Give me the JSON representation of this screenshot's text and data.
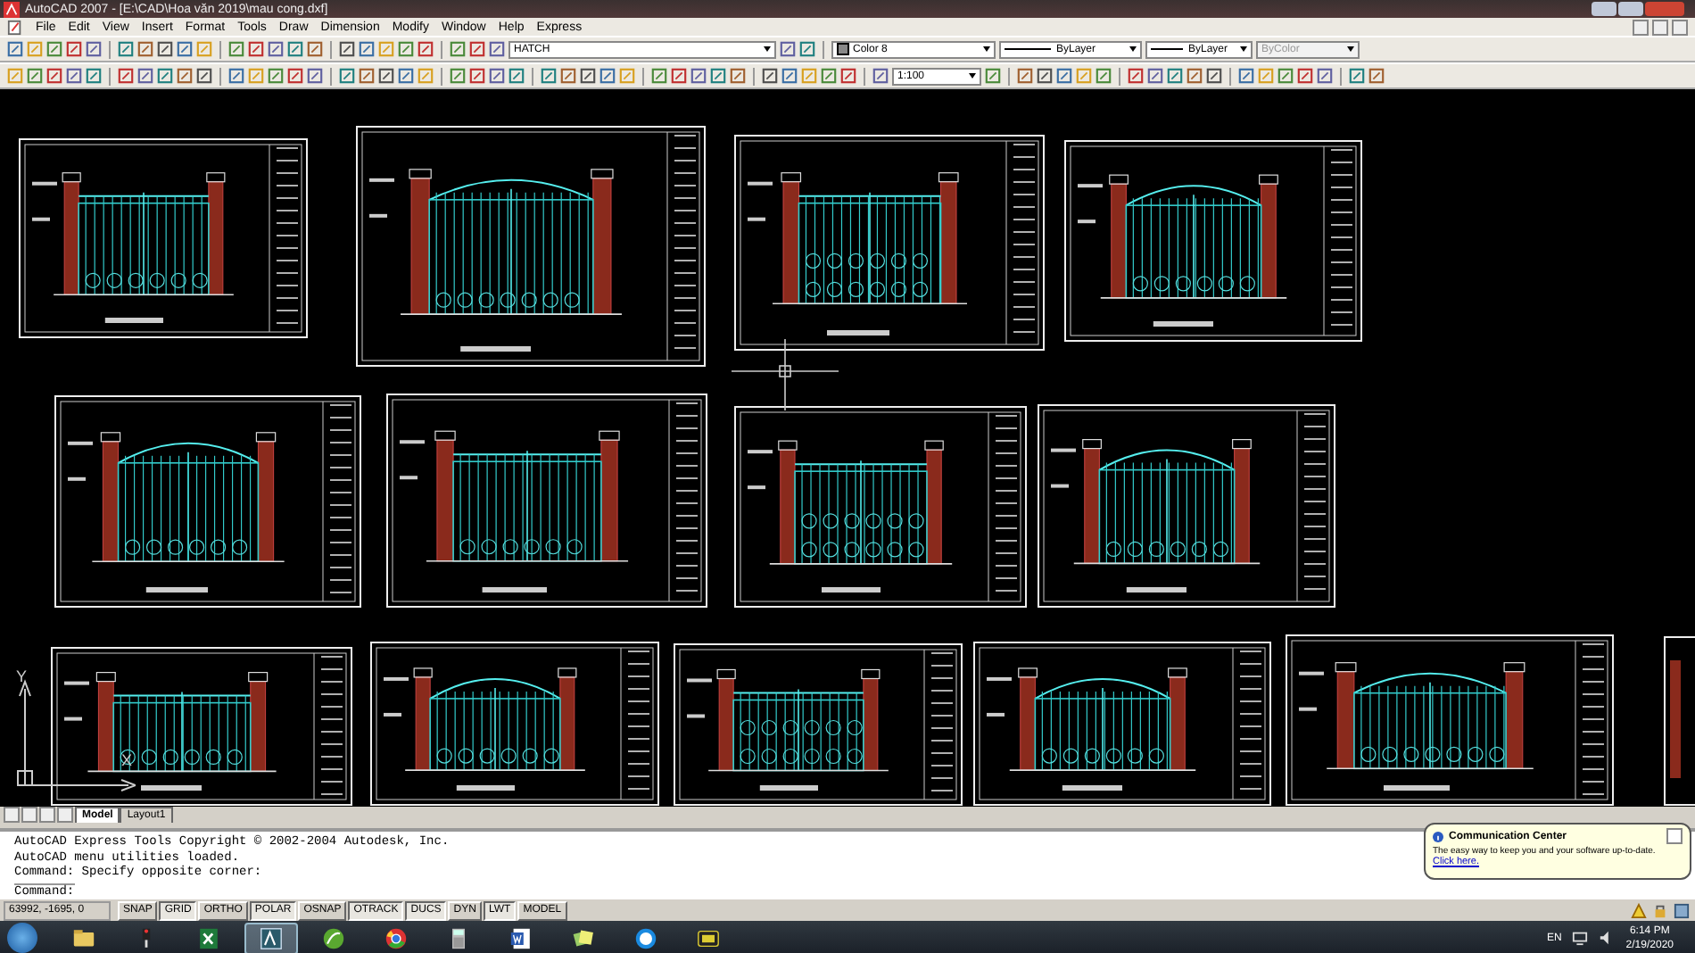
{
  "window": {
    "title": "AutoCAD 2007 - [E:\\CAD\\Hoa văn 2019\\mau cong.dxf]"
  },
  "menu": [
    "File",
    "Edit",
    "View",
    "Insert",
    "Format",
    "Tools",
    "Draw",
    "Dimension",
    "Modify",
    "Window",
    "Help",
    "Express"
  ],
  "toolbar": {
    "layer": "HATCH",
    "color_setting": "Color 8",
    "linetype": "ByLayer",
    "lineweight": "ByLayer",
    "plot_style": "ByColor",
    "scale": "1:100"
  },
  "axis_labels": [
    "Y",
    "X"
  ],
  "layout_tabs": [
    {
      "label": "Model",
      "selected": true
    },
    {
      "label": "Layout1",
      "selected": false
    }
  ],
  "command_lines": [
    "AutoCAD Express Tools Copyright © 2002-2004 Autodesk, Inc.",
    "AutoCAD menu utilities loaded.",
    "Command: Specify opposite corner:"
  ],
  "command_prompt": "Command:",
  "status": {
    "coordinates": "63992, -1695, 0",
    "toggles": [
      {
        "label": "SNAP",
        "on": false
      },
      {
        "label": "GRID",
        "on": true
      },
      {
        "label": "ORTHO",
        "on": false
      },
      {
        "label": "POLAR",
        "on": true
      },
      {
        "label": "OSNAP",
        "on": false
      },
      {
        "label": "OTRACK",
        "on": true
      },
      {
        "label": "DUCS",
        "on": true
      },
      {
        "label": "DYN",
        "on": false
      },
      {
        "label": "LWT",
        "on": true
      },
      {
        "label": "MODEL",
        "on": false
      }
    ]
  },
  "notification": {
    "title": "Communication Center",
    "message": "The easy way to keep you and your software up-to-date.",
    "link": "Click here."
  },
  "taskbar": {
    "apps": [
      {
        "kind": "folder",
        "selected": false
      },
      {
        "kind": "media",
        "selected": false
      },
      {
        "kind": "spreadsheet",
        "selected": false
      },
      {
        "kind": "cad",
        "selected": true
      },
      {
        "kind": "leaf",
        "selected": false
      },
      {
        "kind": "browser",
        "selected": false
      },
      {
        "kind": "calculator",
        "selected": false
      },
      {
        "kind": "document",
        "selected": false
      },
      {
        "kind": "notes",
        "selected": false
      },
      {
        "kind": "chat",
        "selected": false
      },
      {
        "kind": "archive",
        "selected": false
      }
    ],
    "language": "EN",
    "time": "6:14 PM",
    "date": "2/19/2020"
  }
}
